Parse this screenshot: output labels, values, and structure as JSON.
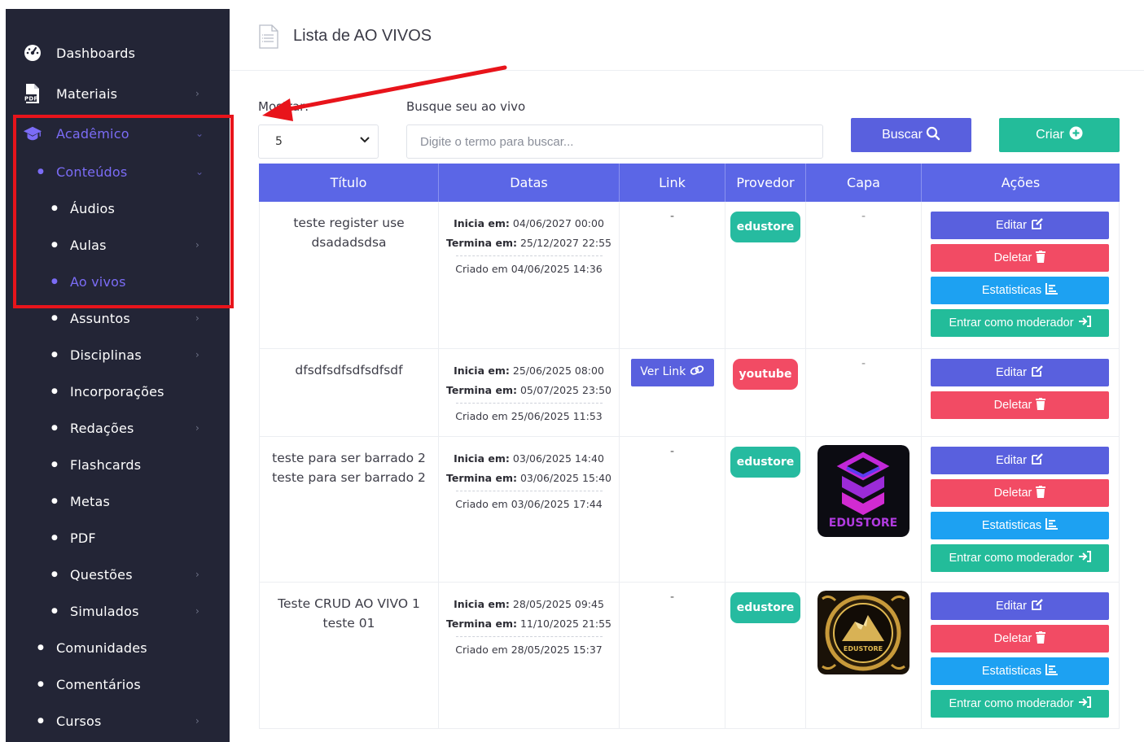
{
  "sidebar": {
    "items": [
      {
        "label": "Dashboards",
        "icon": "dashboard-gauge-icon"
      },
      {
        "label": "Materiais",
        "icon": "pdf-file-icon"
      },
      {
        "label": "Acadêmico",
        "icon": "graduation-cap-icon"
      },
      {
        "label": "Conteúdos"
      },
      {
        "label": "Áudios"
      },
      {
        "label": "Aulas"
      },
      {
        "label": "Ao vivos"
      },
      {
        "label": "Assuntos"
      },
      {
        "label": "Disciplinas"
      },
      {
        "label": "Incorporações"
      },
      {
        "label": "Redações"
      },
      {
        "label": "Flashcards"
      },
      {
        "label": "Metas"
      },
      {
        "label": "PDF"
      },
      {
        "label": "Questões"
      },
      {
        "label": "Simulados"
      },
      {
        "label": "Comunidades"
      },
      {
        "label": "Comentários"
      },
      {
        "label": "Cursos"
      }
    ]
  },
  "header": {
    "title": "Lista de AO VIVOS"
  },
  "filters": {
    "show_label": "Mostrar:",
    "show_value": "5",
    "search_label": "Busque seu ao vivo",
    "search_placeholder": "Digite o termo para buscar...",
    "search_button": "Buscar",
    "create_button": "Criar"
  },
  "table": {
    "columns": [
      "Título",
      "Datas",
      "Link",
      "Provedor",
      "Capa",
      "Ações"
    ],
    "labels": {
      "starts": "Inicia em:",
      "ends": "Termina em:",
      "created": "Criado em",
      "see_link": "Ver Link",
      "edit": "Editar",
      "delete": "Deletar",
      "stats": "Estatisticas",
      "moderator": "Entrar como moderador",
      "empty": "-"
    },
    "rows": [
      {
        "title_line1": "teste register use",
        "title_line2": "dsadadsdsa",
        "starts": "04/06/2027 00:00",
        "ends": "25/12/2027 22:55",
        "created": "04/06/2025 14:36",
        "link": "-",
        "provider": "edustore",
        "cover": "-"
      },
      {
        "title_line1": "dfsdfsdfsdfsdfsdf",
        "title_line2": "",
        "starts": "25/06/2025 08:00",
        "ends": "05/07/2025 23:50",
        "created": "25/06/2025 11:53",
        "link": "Ver Link",
        "provider": "youtube",
        "cover": "-"
      },
      {
        "title_line1": "teste para ser barrado 2",
        "title_line2": "teste para ser barrado 2",
        "starts": "03/06/2025 14:40",
        "ends": "03/06/2025 15:40",
        "created": "03/06/2025 17:44",
        "link": "-",
        "provider": "edustore",
        "cover": "edustore-purple-logo"
      },
      {
        "title_line1": "Teste CRUD AO VIVO 1",
        "title_line2": "teste 01",
        "starts": "28/05/2025 09:45",
        "ends": "11/10/2025 21:55",
        "created": "28/05/2025 15:37",
        "link": "-",
        "provider": "edustore",
        "cover": "edustore-gold-logo"
      }
    ]
  },
  "colors": {
    "sidebar_bg": "#232536",
    "accent_purple": "#7b6cf6",
    "primary": "#5960de",
    "danger": "#f24b64",
    "info": "#1da1f2",
    "success": "#23bc9a",
    "highlight_red": "#e8141b"
  }
}
